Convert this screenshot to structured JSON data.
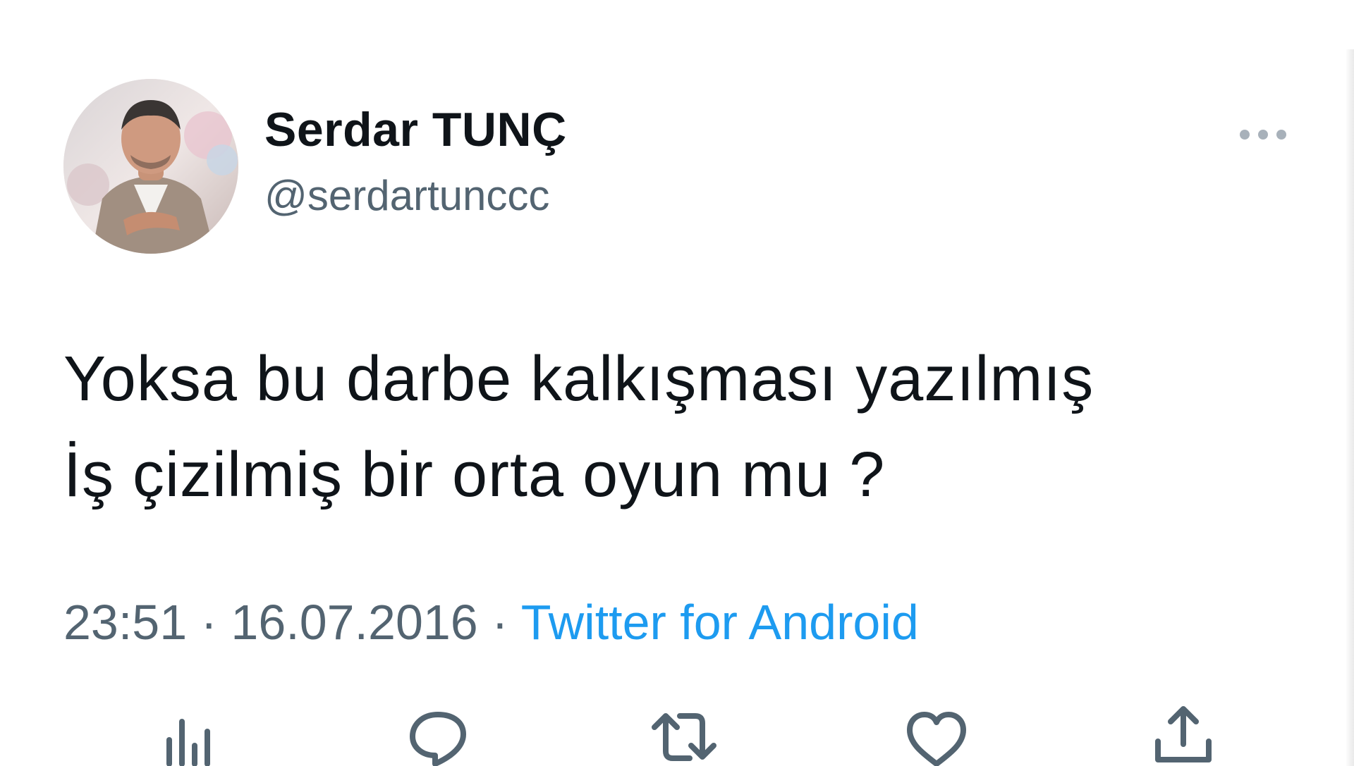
{
  "user": {
    "display_name": "Serdar TUNÇ",
    "handle": "@serdartunccc"
  },
  "tweet": {
    "lines": [
      "Yoksa bu darbe kalkışması yazılmış",
      "İş çizilmiş bir orta oyun mu ?"
    ],
    "time": "23:51",
    "date": "16.07.2016",
    "separator": "·",
    "source": "Twitter for Android"
  },
  "icons": {
    "more": "more-dots-icon",
    "analytics": "analytics-icon",
    "reply": "reply-icon",
    "retweet": "retweet-icon",
    "like": "like-icon",
    "share": "share-icon"
  },
  "colors": {
    "text_primary": "#0f1419",
    "text_secondary": "#536471",
    "link": "#1d9bf0",
    "icon": "#536471"
  }
}
